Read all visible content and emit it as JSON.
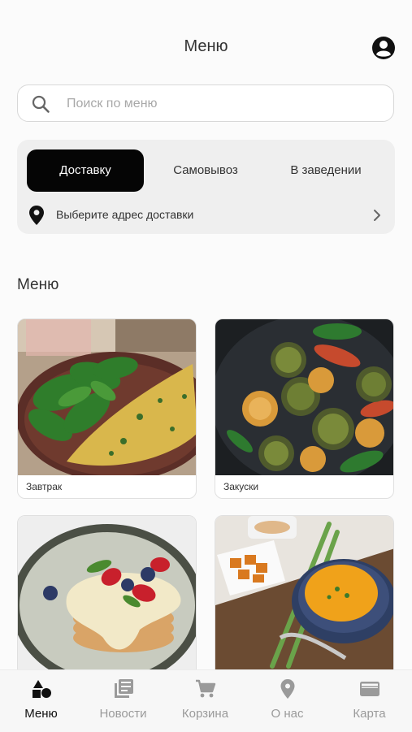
{
  "header": {
    "title": "Меню"
  },
  "search": {
    "placeholder": "Поиск по меню",
    "value": ""
  },
  "delivery": {
    "tabs": [
      {
        "label": "Доставку",
        "active": true
      },
      {
        "label": "Самовывоз",
        "active": false
      },
      {
        "label": "В заведении",
        "active": false
      }
    ],
    "address_prompt": "Выберите адрес доставки"
  },
  "menu": {
    "section_title": "Меню",
    "categories": [
      {
        "label": "Завтрак",
        "image": "omelette-with-spinach"
      },
      {
        "label": "Закуски",
        "image": "zucchini-appetizers"
      },
      {
        "label": "",
        "image": "pancakes-with-berries"
      },
      {
        "label": "",
        "image": "pumpkin-soup"
      }
    ]
  },
  "tabbar": {
    "items": [
      {
        "label": "Меню",
        "icon": "shapes-icon",
        "active": true
      },
      {
        "label": "Новости",
        "icon": "news-icon",
        "active": false
      },
      {
        "label": "Корзина",
        "icon": "cart-icon",
        "active": false
      },
      {
        "label": "О нас",
        "icon": "location-icon",
        "active": false
      },
      {
        "label": "Карта",
        "icon": "card-icon",
        "active": false
      }
    ]
  },
  "colors": {
    "accent": "#050505",
    "background": "#fbfbfb",
    "inactive": "#9a9a9a"
  }
}
